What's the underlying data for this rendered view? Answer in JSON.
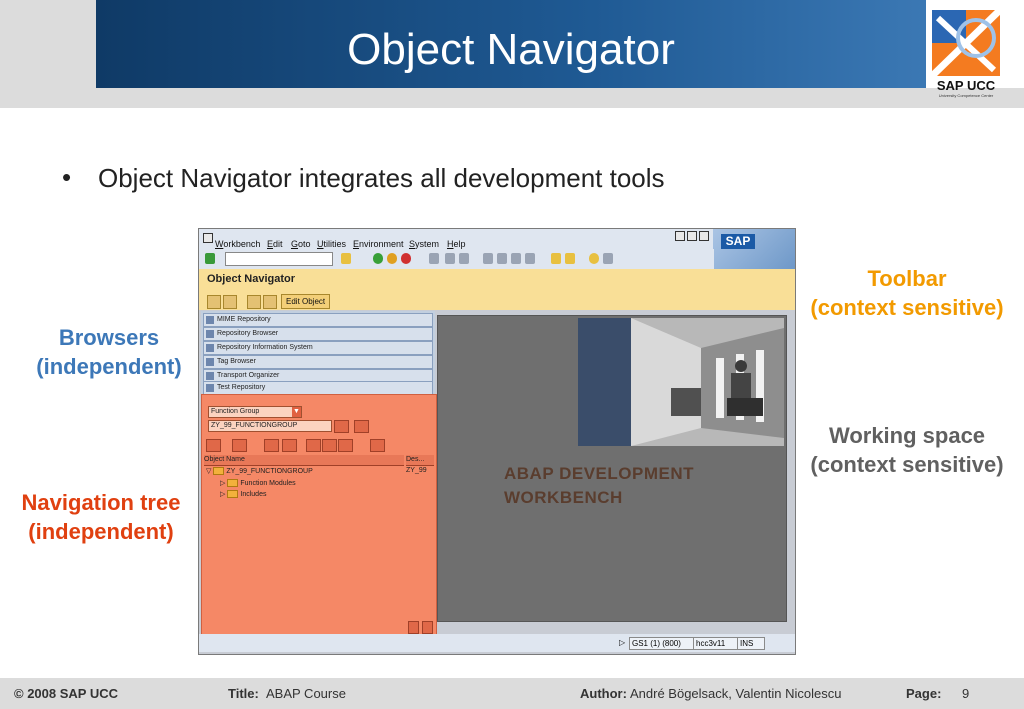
{
  "slide": {
    "title": "Object Navigator",
    "bullet": "Object Navigator integrates all development tools",
    "logo_text": "SAP UCC",
    "logo_subtext": "University Competence Center"
  },
  "labels": {
    "toolbar": [
      "Toolbar",
      "(context sensitive)"
    ],
    "browsers": [
      "Browsers",
      "(independent)"
    ],
    "working_space": [
      "Working space",
      "(context sensitive)"
    ],
    "navigation_tree": [
      "Navigation tree",
      "(independent)"
    ]
  },
  "sap": {
    "menu": [
      {
        "key": "W",
        "rest": "orkbench"
      },
      {
        "key": "E",
        "rest": "dit"
      },
      {
        "key": "G",
        "rest": "oto"
      },
      {
        "key": "U",
        "rest": "tilities"
      },
      {
        "key": "E",
        "rest": "nvironment"
      },
      {
        "key": "S",
        "rest": "ystem"
      },
      {
        "key": "H",
        "rest": "elp"
      }
    ],
    "logo": "SAP",
    "screen_title": "Object Navigator",
    "edit_object_label": "Edit Object",
    "browsers": [
      "MIME Repository",
      "Repository Browser",
      "Repository Information System",
      "Tag Browser",
      "Transport Organizer",
      "Test Repository"
    ],
    "nav": {
      "object_type": "Function Group",
      "object_name": "ZY_99_FUNCTIONGROUP",
      "col_object_name": "Object Name",
      "col_description": "Des...",
      "tree": [
        {
          "label": "ZY_99_FUNCTIONGROUP",
          "desc": "ZY_99"
        },
        {
          "label": "Function Modules",
          "desc": ""
        },
        {
          "label": "Includes",
          "desc": ""
        }
      ]
    },
    "workspace": {
      "line1": "ABAP DEVELOPMENT",
      "line2": "WORKBENCH"
    },
    "status": {
      "system": "GS1 (1) (800)",
      "server": "hcc3v11",
      "mode": "INS"
    }
  },
  "footer": {
    "copyright": "© 2008 SAP UCC",
    "title_label": "Title:",
    "title_value": "ABAP Course",
    "author_label": "Author:",
    "author_value": "André Bögelsack, Valentin Nicolescu",
    "page_label": "Page:",
    "page_value": "9"
  },
  "colors": {
    "header": "#1f5a94",
    "toolbar_label": "#f29a00",
    "browsers_label": "#3d78b8",
    "working_space_label": "#606060",
    "navigation_label": "#e04010",
    "nav_panel": "#f58866"
  }
}
